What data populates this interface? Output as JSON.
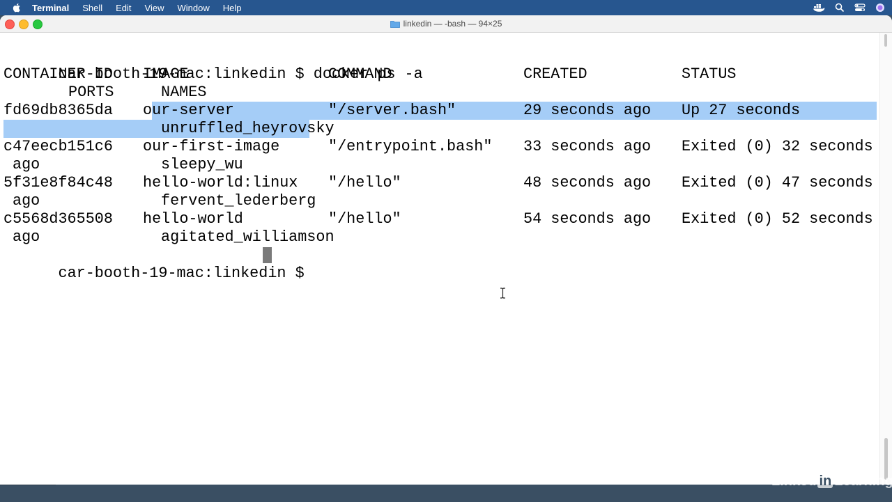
{
  "menubar": {
    "app_name": "Terminal",
    "items": [
      "Shell",
      "Edit",
      "View",
      "Window",
      "Help"
    ]
  },
  "window": {
    "title": "linkedin — -bash — 94×25"
  },
  "terminal": {
    "prompt": "car-booth-19-mac:linkedin $ ",
    "command": "docker ps -a",
    "headers": {
      "container_id": "CONTAINER ID",
      "image": "IMAGE",
      "command": "COMMAND",
      "created": "CREATED",
      "status": "STATUS",
      "ports": "PORTS",
      "names": "NAMES"
    },
    "rows": [
      {
        "container_id": "fd69db8365da",
        "image_first": "o",
        "image_rest": "ur-server",
        "command": "\"/server.bash\"",
        "created": "29 seconds ago",
        "status": "Up 27 seconds",
        "status_wrap": "",
        "names_selected": "unruffled_heyrov",
        "names_rest": "sky"
      },
      {
        "container_id": "c47eecb151c6",
        "image": "our-first-image",
        "command": "\"/entrypoint.bash\"",
        "created": "33 seconds ago",
        "status": "Exited (0) 32 seconds",
        "status_wrap": "ago",
        "names": "sleepy_wu"
      },
      {
        "container_id": "5f31e8f84c48",
        "image": "hello-world:linux",
        "command": "\"/hello\"",
        "created": "48 seconds ago",
        "status": "Exited (0) 47 seconds",
        "status_wrap": "ago",
        "names": "fervent_lederberg"
      },
      {
        "container_id": "c5568d365508",
        "image": "hello-world",
        "command": "\"/hello\"",
        "created": "54 seconds ago",
        "status": "Exited (0) 52 seconds",
        "status_wrap": "ago",
        "names": "agitated_williamson"
      }
    ],
    "final_prompt": "car-booth-19-mac:linkedin $ "
  },
  "watermark": {
    "before": "Linked",
    "box": "in",
    "after": "Learning"
  },
  "colors": {
    "menubar": "#27568f",
    "selection": "#a5cdf7",
    "desktop": "#3a4f63"
  },
  "icons": [
    "apple-icon",
    "docker-icon",
    "search-icon",
    "control-center-icon",
    "siri-icon",
    "folder-icon",
    "ibeam-cursor-icon"
  ]
}
